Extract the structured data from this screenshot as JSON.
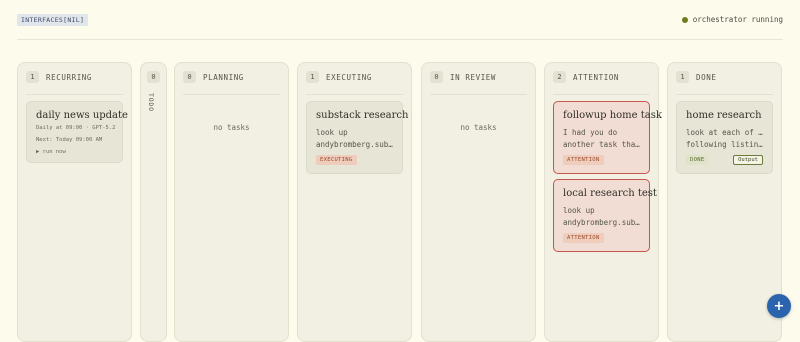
{
  "header": {
    "brand": "INTERFACES[NIL]",
    "status": "orchestrator running"
  },
  "columns": {
    "recurring": {
      "count": "1",
      "title": "RECURRING"
    },
    "todo": {
      "count": "0",
      "title": "TODO"
    },
    "planning": {
      "count": "0",
      "title": "PLANNING",
      "empty": "no tasks"
    },
    "executing": {
      "count": "1",
      "title": "EXECUTING"
    },
    "in_review": {
      "count": "0",
      "title": "IN REVIEW",
      "empty": "no tasks"
    },
    "attention": {
      "count": "2",
      "title": "ATTENTION"
    },
    "done": {
      "count": "1",
      "title": "DONE"
    }
  },
  "cards": {
    "recurring": {
      "title": "daily news update",
      "schedule": "Daily at 09:00 · GPT-5.2",
      "next": "Next: Today 09:00 AM",
      "run_now": "▶ run now"
    },
    "executing": {
      "title": "substack research",
      "desc_line1": "look up",
      "desc_line2": "andybromberg.subst...",
      "badge": "EXECUTING"
    },
    "attention1": {
      "title": "followup home task",
      "desc_line1": "I had you do",
      "desc_line2": "another task that...",
      "badge": "ATTENTION"
    },
    "attention2": {
      "title": "local research test",
      "desc_line1": "look up",
      "desc_line2": "andybromberg.subst...",
      "badge": "ATTENTION"
    },
    "done": {
      "title": "home research",
      "desc_line1": "look at each of the",
      "desc_line2": "following listings, a...",
      "badge": "DONE",
      "output": "Output"
    }
  },
  "fab": {
    "label": "+"
  },
  "colors": {
    "background": "#fcfbec",
    "accent": "#2b64ad",
    "attention_border": "#c7554f",
    "status_dot": "#6f7a1e"
  }
}
